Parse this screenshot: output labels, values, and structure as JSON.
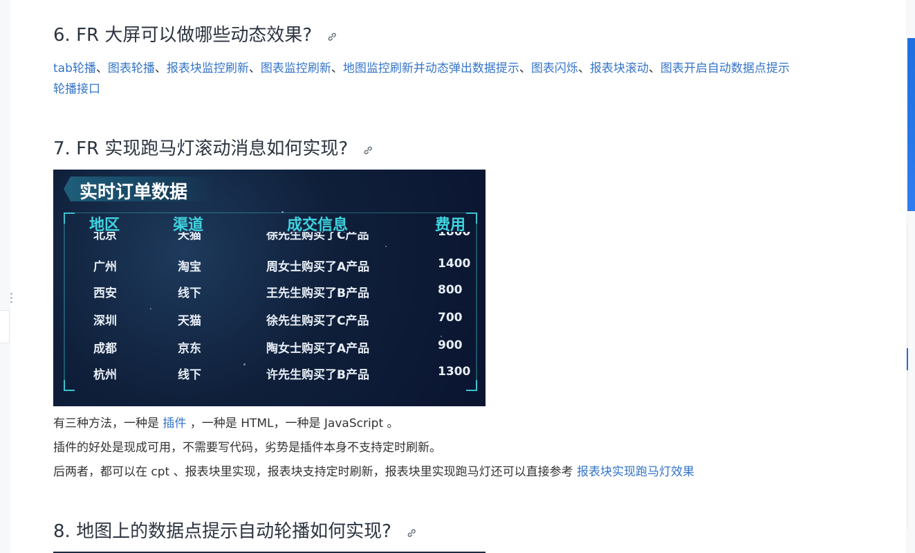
{
  "section6": {
    "heading": "6. FR 大屏可以做哪些动态效果?",
    "effects": [
      {
        "text": "tab轮播",
        "sep": "、"
      },
      {
        "text": "图表轮播",
        "sep": "、"
      },
      {
        "text": "报表块监控刷新",
        "sep": "、"
      },
      {
        "text": "图表监控刷新",
        "sep": "、"
      },
      {
        "text": "地图监控刷新并动态弹出数据提示",
        "sep": "、"
      },
      {
        "text": "图表闪烁",
        "sep": "、"
      },
      {
        "text": "报表块滚动",
        "sep": "、"
      },
      {
        "text": "图表开启自动数据点提示",
        "sep": ""
      }
    ],
    "effect_line2": "轮播接口"
  },
  "section7": {
    "heading": "7. FR 实现跑马灯滚动消息如何实现?",
    "screenshot": {
      "title": "实时订单数据",
      "columns": [
        "地区",
        "渠道",
        "成交信息",
        "费用"
      ],
      "rows": [
        {
          "region": "北京",
          "channel": "天猫",
          "info": "徐先生购买了C产品",
          "cost": "1800"
        },
        {
          "region": "广州",
          "channel": "淘宝",
          "info": "周女士购买了A产品",
          "cost": "1400"
        },
        {
          "region": "西安",
          "channel": "线下",
          "info": "王先生购买了B产品",
          "cost": "800"
        },
        {
          "region": "深圳",
          "channel": "天猫",
          "info": "徐先生购买了C产品",
          "cost": "700"
        },
        {
          "region": "成都",
          "channel": "京东",
          "info": "陶女士购买了A产品",
          "cost": "900"
        },
        {
          "region": "杭州",
          "channel": "线下",
          "info": "许先生购买了B产品",
          "cost": "1300"
        }
      ]
    },
    "p1_prefix": "有三种方法，一种是 ",
    "p1_link": "插件",
    "p1_suffix": " ，一种是 HTML，一种是 JavaScript 。",
    "p2": "插件的好处是现成可用，不需要写代码，劣势是插件本身不支持定时刷新。",
    "p3_prefix": "后两者，都可以在 cpt 、报表块里实现，报表块支持定时刷新，报表块里实现跑马灯还可以直接参考 ",
    "p3_link": "报表块实现跑马灯效果"
  },
  "section8": {
    "heading": "8. 地图上的数据点提示自动轮播如何实现?"
  },
  "colors": {
    "link": "#3474c8",
    "heading": "#2c3440",
    "accent": "#1f6fe0",
    "table_header": "#3fd4e0"
  },
  "icons": {
    "anchor": "link-icon",
    "drag": "drag-handle-icon"
  }
}
